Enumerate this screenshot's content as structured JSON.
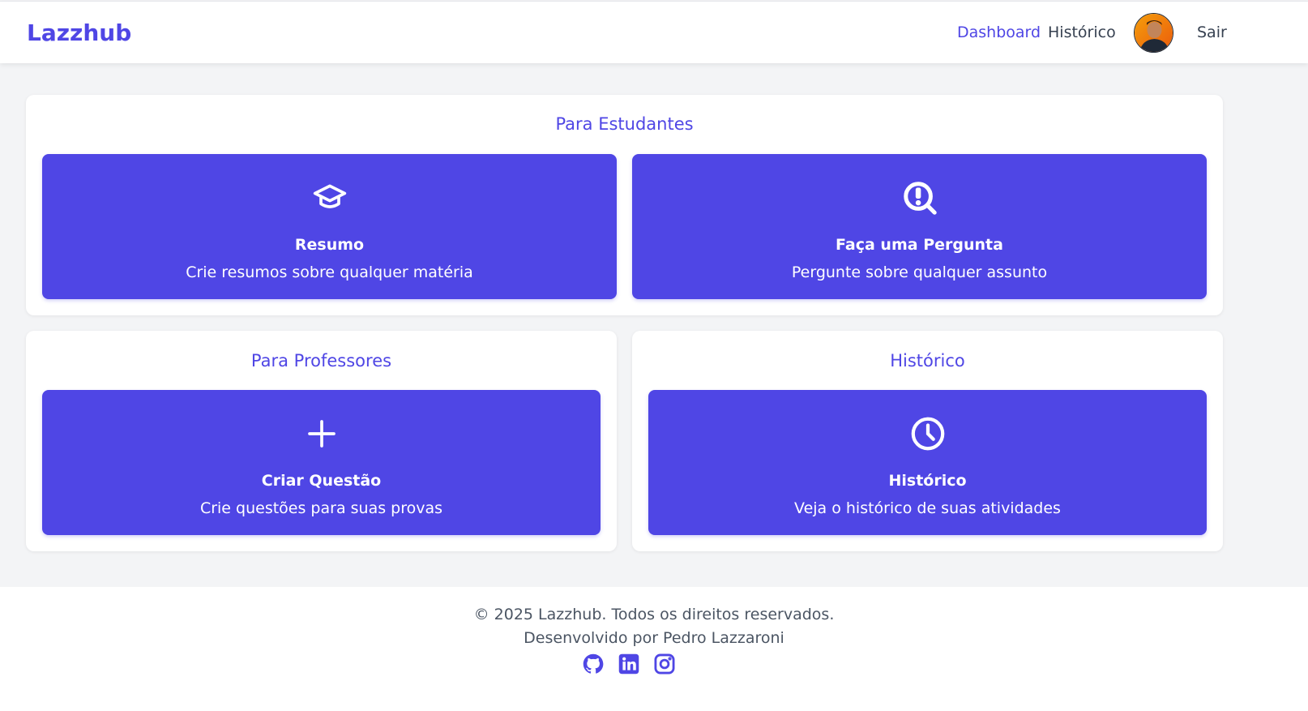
{
  "header": {
    "brand": "Lazzhub",
    "nav": {
      "dashboard": "Dashboard",
      "historico": "Histórico",
      "logout": "Sair"
    },
    "active": "dashboard"
  },
  "sections": {
    "students": {
      "title": "Para Estudantes",
      "cards": [
        {
          "icon": "graduation-cap-icon",
          "title": "Resumo",
          "description": "Crie resumos sobre qualquer matéria"
        },
        {
          "icon": "question-search-icon",
          "title": "Faça uma Pergunta",
          "description": "Pergunte sobre qualquer assunto"
        }
      ]
    },
    "teachers": {
      "title": "Para Professores",
      "cards": [
        {
          "icon": "plus-icon",
          "title": "Criar Questão",
          "description": "Crie questões para suas provas"
        }
      ]
    },
    "history": {
      "title": "Histórico",
      "cards": [
        {
          "icon": "clock-icon",
          "title": "Histórico",
          "description": "Veja o histórico de suas atividades"
        }
      ]
    }
  },
  "footer": {
    "copyright": "© 2025 Lazzhub. Todos os direitos reservados.",
    "developer": "Desenvolvido por Pedro Lazzaroni",
    "social": [
      "github-icon",
      "linkedin-icon",
      "instagram-icon"
    ]
  },
  "colors": {
    "accent": "#4f46e5",
    "background": "#f3f4f6",
    "surface": "#ffffff",
    "text": "#374151"
  }
}
